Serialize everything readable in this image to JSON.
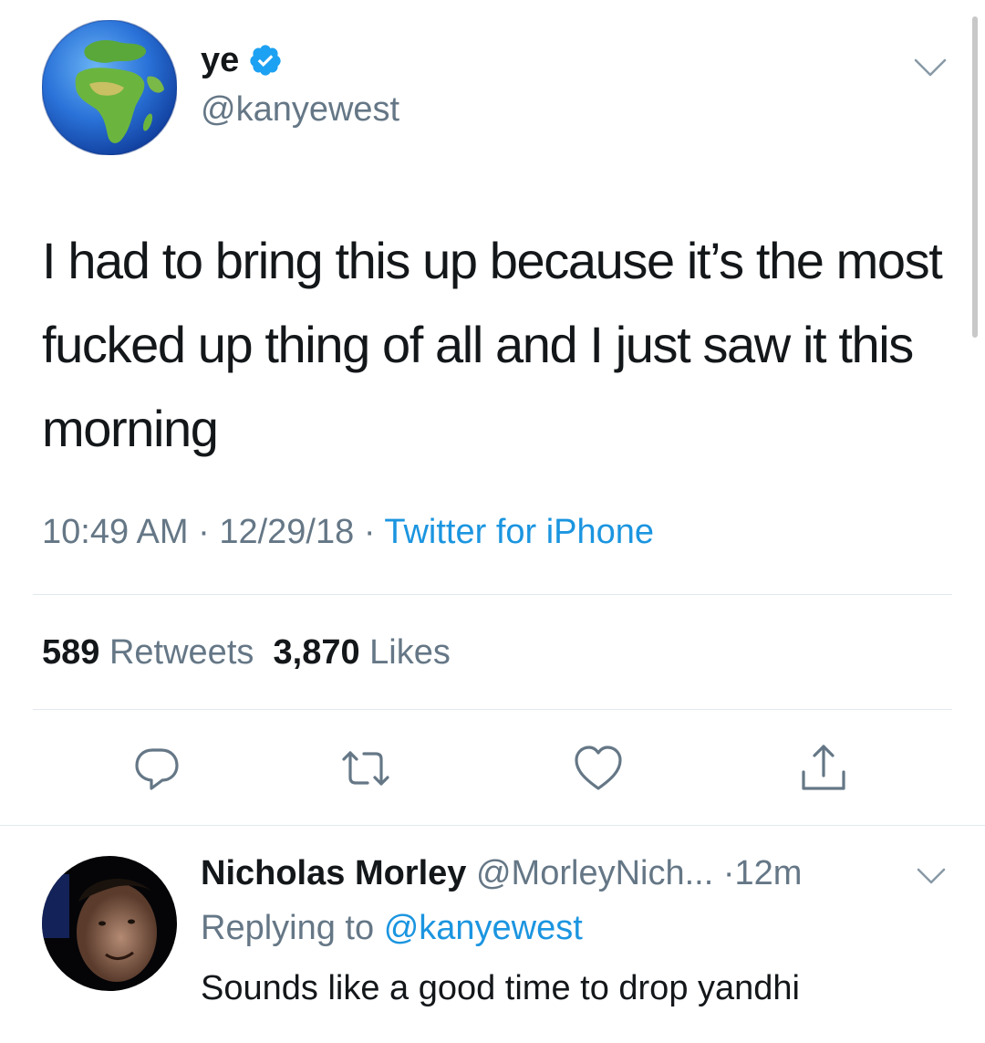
{
  "tweet": {
    "author": {
      "name": "ye",
      "handle": "@kanyewest",
      "avatar": "globe-europe-africa-icon",
      "verified_icon": "verified-badge-icon"
    },
    "text": "I had to bring this up because it’s the most fucked up thing of all and I just saw it this morning",
    "time": "10:49 AM",
    "date": "12/29/18",
    "separator": "·",
    "source": "Twitter for iPhone",
    "retweets_count": "589",
    "retweets_label": "Retweets",
    "likes_count": "3,870",
    "likes_label": "Likes"
  },
  "actions": [
    {
      "icon": "reply-icon"
    },
    {
      "icon": "retweet-icon"
    },
    {
      "icon": "like-icon"
    },
    {
      "icon": "share-icon"
    }
  ],
  "reply": {
    "name": "Nicholas Morley",
    "handle": "@MorleyNich...",
    "time": "12m",
    "separator": "·",
    "replying_label": "Replying to",
    "replying_handle": "@kanyewest",
    "text": "Sounds like a good time to drop yandhi",
    "avatar": "profile-photo"
  },
  "colors": {
    "accent": "#1b95e0",
    "text_primary": "#14171a",
    "text_secondary": "#657786",
    "divider": "#e1e8ed",
    "verified": "#1da1f2"
  }
}
